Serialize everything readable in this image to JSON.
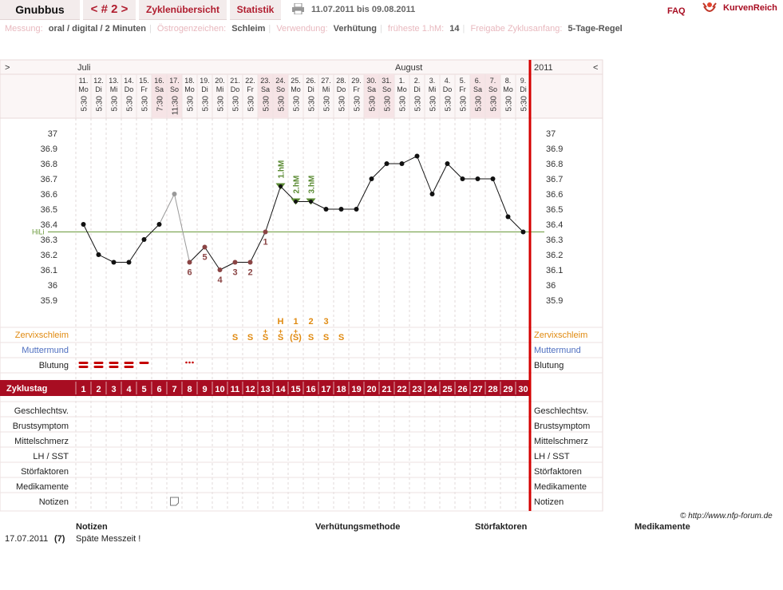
{
  "header": {
    "name": "Gnubbus",
    "cycle_nav": "< # 2 >",
    "tab_overview": "Zyklenübersicht",
    "tab_stats": "Statistik",
    "date_range": "11.07.2011 bis 09.08.2011",
    "faq": "FAQ",
    "brand": "KurvenReich"
  },
  "settings": {
    "l1": "Messung:",
    "v1": "oral / digital / 2 Minuten",
    "l2": "Östrogenzeichen:",
    "v2": "Schleim",
    "l3": "Verwendung:",
    "v3": "Verhütung",
    "l4": "früheste 1.hM:",
    "v4": "14",
    "l5": "Freigabe Zyklusanfang:",
    "v5": "5-Tage-Regel"
  },
  "nav": {
    "prev": ">",
    "next": "<",
    "year": "2011"
  },
  "months": {
    "m1": "Juli",
    "m2": "August"
  },
  "days": [
    {
      "d": "11.",
      "w": "Mo",
      "t": "5:30"
    },
    {
      "d": "12.",
      "w": "Di",
      "t": "5:30"
    },
    {
      "d": "13.",
      "w": "Mi",
      "t": "5:30"
    },
    {
      "d": "14.",
      "w": "Do",
      "t": "5:30"
    },
    {
      "d": "15.",
      "w": "Fr",
      "t": "5:30"
    },
    {
      "d": "16.",
      "w": "Sa",
      "t": "7:30"
    },
    {
      "d": "17.",
      "w": "So",
      "t": "11:30"
    },
    {
      "d": "18.",
      "w": "Mo",
      "t": "5:30"
    },
    {
      "d": "19.",
      "w": "Di",
      "t": "5:30"
    },
    {
      "d": "20.",
      "w": "Mi",
      "t": "5:30"
    },
    {
      "d": "21.",
      "w": "Do",
      "t": "5:30"
    },
    {
      "d": "22.",
      "w": "Fr",
      "t": "5:30"
    },
    {
      "d": "23.",
      "w": "Sa",
      "t": "5:30"
    },
    {
      "d": "24.",
      "w": "So",
      "t": "5:30"
    },
    {
      "d": "25.",
      "w": "Mo",
      "t": "5:30"
    },
    {
      "d": "26.",
      "w": "Di",
      "t": "5:30"
    },
    {
      "d": "27.",
      "w": "Mi",
      "t": "5:30"
    },
    {
      "d": "28.",
      "w": "Do",
      "t": "5:30"
    },
    {
      "d": "29.",
      "w": "Fr",
      "t": "5:30"
    },
    {
      "d": "30.",
      "w": "Sa",
      "t": "5:30"
    },
    {
      "d": "31.",
      "w": "So",
      "t": "5:30"
    },
    {
      "d": "1.",
      "w": "Mo",
      "t": "5:30"
    },
    {
      "d": "2.",
      "w": "Di",
      "t": "5:30"
    },
    {
      "d": "3.",
      "w": "Mi",
      "t": "5:30"
    },
    {
      "d": "4.",
      "w": "Do",
      "t": "5:30"
    },
    {
      "d": "5.",
      "w": "Fr",
      "t": "5:30"
    },
    {
      "d": "6.",
      "w": "Sa",
      "t": "5:30"
    },
    {
      "d": "7.",
      "w": "So",
      "t": "5:30"
    },
    {
      "d": "8.",
      "w": "Mo",
      "t": "5:30"
    },
    {
      "d": "9.",
      "w": "Di",
      "t": "5:30"
    }
  ],
  "chart_data": {
    "type": "line",
    "y_ticks": [
      "37",
      "36.9",
      "36.8",
      "36.7",
      "36.6",
      "36.5",
      "36.4",
      "36.3",
      "36.2",
      "36.1",
      "36",
      "35.9"
    ],
    "ylim": [
      35.9,
      37.0
    ],
    "x": [
      1,
      2,
      3,
      4,
      5,
      6,
      7,
      8,
      9,
      10,
      11,
      12,
      13,
      14,
      15,
      16,
      17,
      18,
      19,
      20,
      21,
      22,
      23,
      24,
      25,
      26,
      27,
      28,
      29,
      30
    ],
    "values": [
      36.4,
      36.2,
      36.15,
      36.15,
      36.3,
      36.4,
      36.6,
      36.15,
      36.25,
      36.1,
      36.15,
      36.15,
      36.35,
      36.65,
      36.55,
      36.55,
      36.5,
      36.5,
      36.5,
      36.7,
      36.8,
      36.8,
      36.85,
      36.6,
      36.8,
      36.7,
      36.7,
      36.7,
      36.45,
      36.35
    ],
    "excluded_day": 7,
    "hl_label": "HiLi",
    "hl_value": 36.35,
    "low_labels": [
      {
        "day": 8,
        "label": "6"
      },
      {
        "day": 9,
        "label": "5"
      },
      {
        "day": 10,
        "label": "4"
      },
      {
        "day": 11,
        "label": "3"
      },
      {
        "day": 12,
        "label": "2"
      },
      {
        "day": 13,
        "label": "1"
      }
    ],
    "hm_labels": [
      {
        "day": 14,
        "label": "1.hM"
      },
      {
        "day": 15,
        "label": "2.hM"
      },
      {
        "day": 16,
        "label": "3.hM"
      }
    ],
    "hm_color": "#5a8a32",
    "low_color": "#8a4444"
  },
  "rows": {
    "zervix": "Zervixschleim",
    "muttermund": "Muttermund",
    "blutung": "Blutung",
    "zyklustag": "Zyklustag",
    "geschlecht": "Geschlechtsv.",
    "brust": "Brustsymptom",
    "mittel": "Mittelschmerz",
    "lh": "LH / SST",
    "stoer": "Störfaktoren",
    "medi": "Medikamente",
    "notizen": "Notizen"
  },
  "zervix_marks": [
    {
      "day": 11,
      "v": "S"
    },
    {
      "day": 12,
      "v": "S"
    },
    {
      "day": 13,
      "v": "S",
      "plus": "+"
    },
    {
      "day": 14,
      "v": "S",
      "plus": "+",
      "top": "H"
    },
    {
      "day": 15,
      "v": "(S)",
      "plus": "+",
      "top": "1"
    },
    {
      "day": 16,
      "v": "S",
      "top": "2"
    },
    {
      "day": 17,
      "v": "S",
      "top": "3"
    },
    {
      "day": 18,
      "v": "S"
    }
  ],
  "zyklustage": [
    "1",
    "2",
    "3",
    "4",
    "5",
    "6",
    "7",
    "8",
    "9",
    "10",
    "11",
    "12",
    "13",
    "14",
    "15",
    "16",
    "17",
    "18",
    "19",
    "20",
    "21",
    "22",
    "23",
    "24",
    "25",
    "26",
    "27",
    "28",
    "29",
    "30"
  ],
  "colors": {
    "accent": "#a80d22",
    "orange": "#e08a10",
    "blue": "#4f6fc0",
    "weekend": "#f6e4e6"
  },
  "footer": {
    "credit": "© http://www.nfp-forum.de",
    "col1": "Notizen",
    "col2": "Verhütungsmethode",
    "col3": "Störfaktoren",
    "col4": "Medikamente",
    "row_date": "17.07.2011",
    "row_num": "(7)",
    "row_note": "Späte Messzeit !"
  }
}
